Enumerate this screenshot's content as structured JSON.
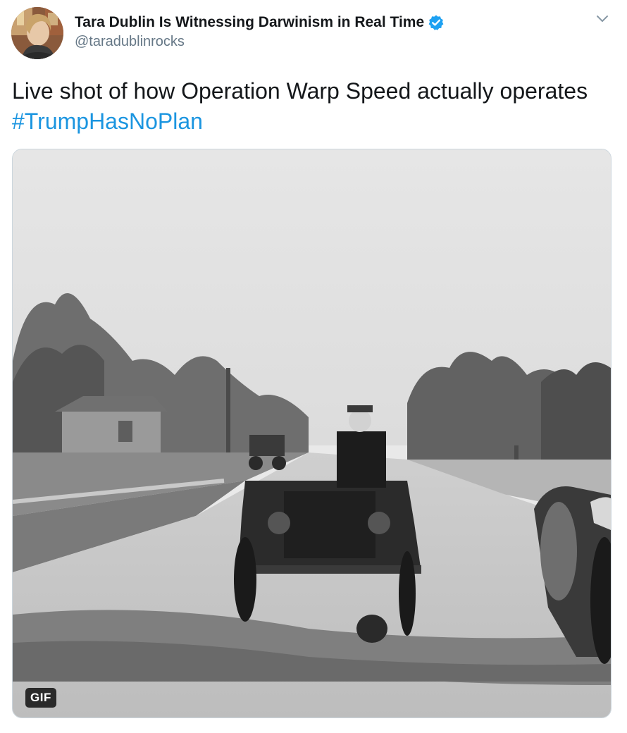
{
  "author": {
    "display_name": "Tara Dublin Is Witnessing Darwinism in Real Time",
    "handle": "@taradublinrocks",
    "verified": true,
    "verified_icon": "verified-badge-icon"
  },
  "menu": {
    "icon": "chevron-down-icon"
  },
  "tweet": {
    "text_main": "Live shot of how Operation Warp Speed actually operates",
    "hashtag": "#TrumpHasNoPlan"
  },
  "media": {
    "badge": "GIF",
    "description_icon": "gif-media"
  },
  "colors": {
    "link": "#1b95e0",
    "verified": "#1da1f2",
    "secondary_text": "#657786",
    "border": "#ccd6dd"
  }
}
